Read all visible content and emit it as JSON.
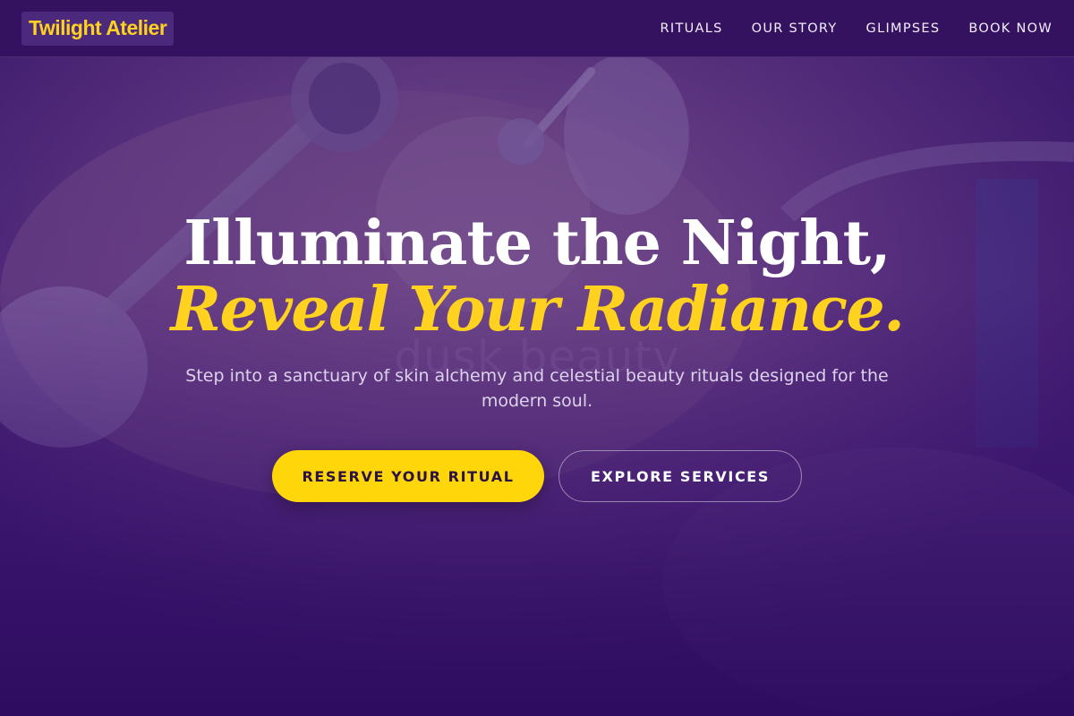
{
  "colors": {
    "brand_accent": "#ffd21f",
    "navbar_bg": "#34125f",
    "hero_overlay": "#3b1670",
    "primary_button": "#ffd60a",
    "headline_white": "#ffffff"
  },
  "navbar": {
    "brand": "Twilight Atelier",
    "links": [
      {
        "label": "RITUALS"
      },
      {
        "label": "OUR STORY"
      },
      {
        "label": "GLIMPSES"
      },
      {
        "label": "BOOK NOW"
      }
    ]
  },
  "hero": {
    "image_description_icon": "hero-photo-icon",
    "watermark": "dusk beauty",
    "headline_line1": "Illuminate the Night,",
    "headline_line2": "Reveal Your Radiance.",
    "subtitle": "Step into a sanctuary of skin alchemy and celestial beauty rituals designed for the modern soul.",
    "primary_cta": "RESERVE YOUR RITUAL",
    "secondary_cta": "EXPLORE SERVICES"
  }
}
